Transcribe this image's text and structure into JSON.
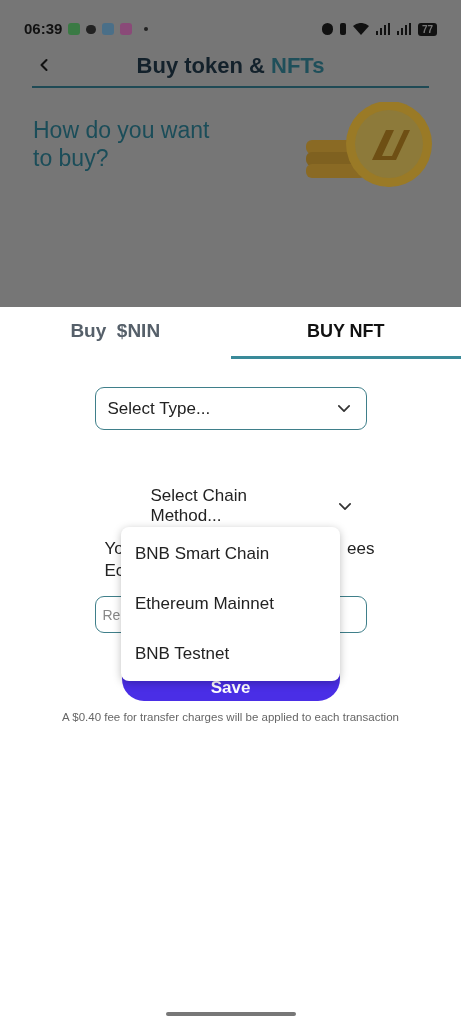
{
  "status_bar": {
    "time": "06:39",
    "battery": "77"
  },
  "header": {
    "title": "Buy token & ",
    "title_accent": "NFTs"
  },
  "hero": {
    "heading": "How do you want to buy?"
  },
  "tabs": [
    {
      "label": "Buy  $NIN",
      "selected": false
    },
    {
      "label": "BUY NFT",
      "selected": true
    }
  ],
  "type_select": {
    "value": "Select Type..."
  },
  "chain_select": {
    "value": "Select Chain Method...",
    "expanded": true
  },
  "hidden_line_1": {
    "start": "Yo",
    "end": "ees"
  },
  "hidden_line_2": {
    "start": "Ec"
  },
  "amount_field": {
    "placeholder": "Re"
  },
  "save_button": {
    "label": "Save"
  },
  "chain_options": [
    {
      "label": "BNB Smart Chain"
    },
    {
      "label": "Ethereum Mainnet"
    },
    {
      "label": "BNB Testnet"
    }
  ],
  "fee_note": "A $0.40 fee for transfer charges will be applied to each transaction"
}
